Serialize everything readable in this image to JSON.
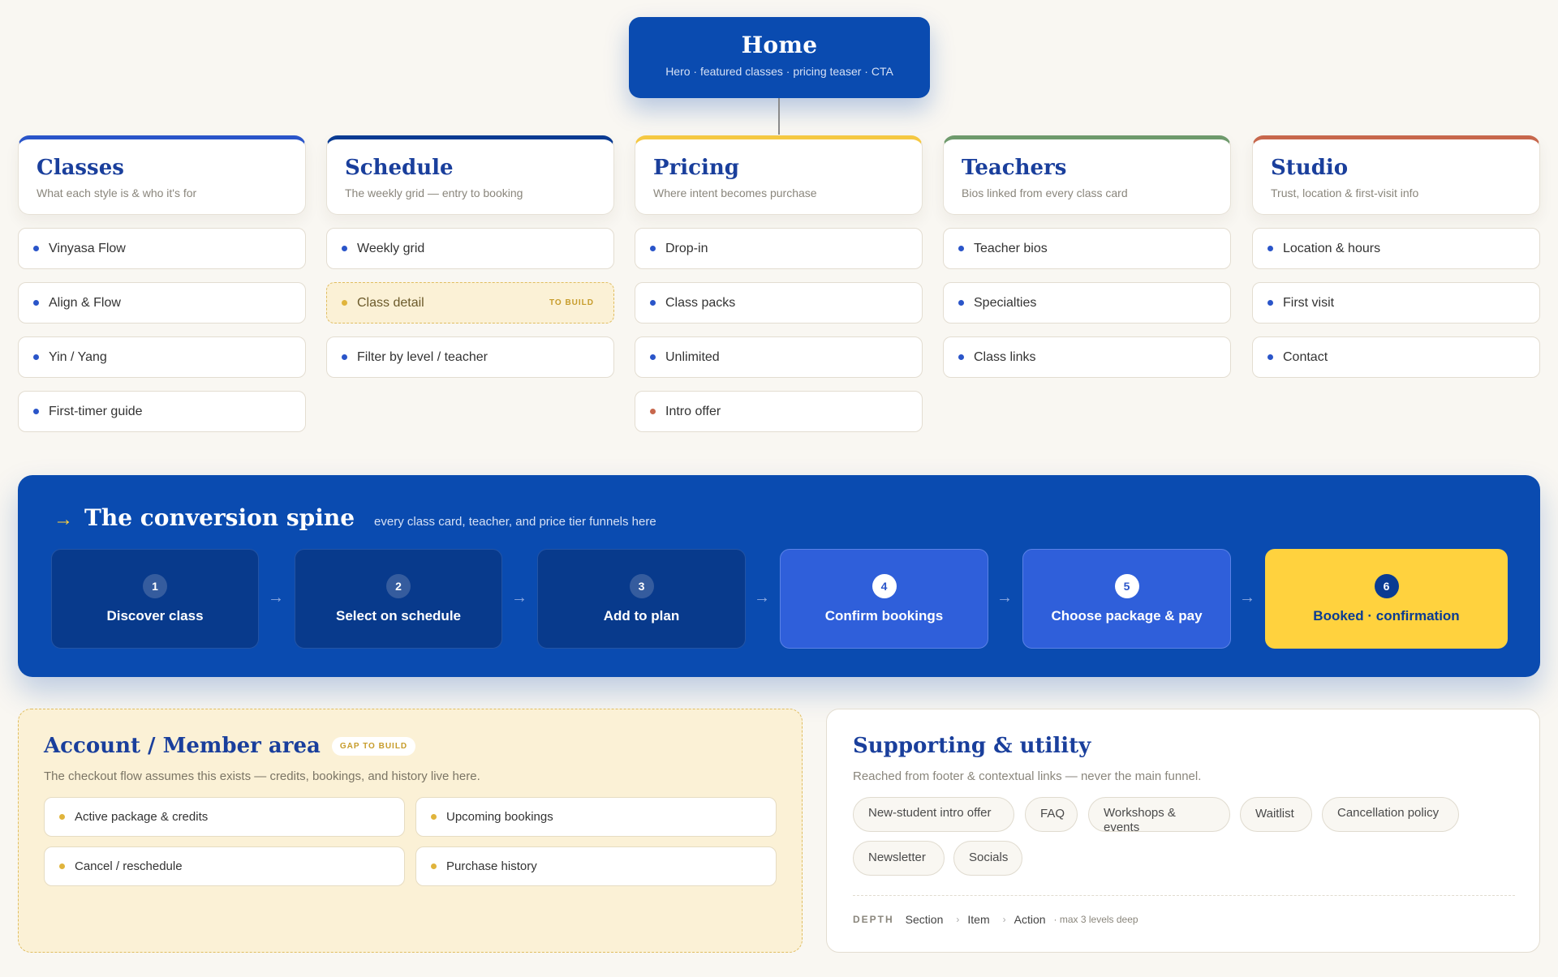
{
  "home": {
    "title": "Home",
    "subtitle": "Hero · featured classes · pricing teaser · CTA"
  },
  "colors": {
    "primary": "#0a4bb0",
    "classes": "#2a55c9",
    "schedule": "#0a3b92",
    "pricing": "#f5c842",
    "teachers": "#6e9a6c",
    "studio": "#c7674c",
    "gold": "#ffd23e",
    "gap_bg": "#fbf1d6"
  },
  "sections": [
    {
      "title": "Classes",
      "subtitle": "What each style is & who it's for",
      "items": [
        {
          "label": "Vinyasa Flow"
        },
        {
          "label": "Align & Flow"
        },
        {
          "label": "Yin / Yang"
        },
        {
          "label": "First-timer guide"
        }
      ]
    },
    {
      "title": "Schedule",
      "subtitle": "The weekly grid — entry to booking",
      "items": [
        {
          "label": "Weekly grid"
        },
        {
          "label": "Class detail",
          "tag": "TO BUILD"
        },
        {
          "label": "Filter by level / teacher"
        }
      ]
    },
    {
      "title": "Pricing",
      "subtitle": "Where intent becomes purchase",
      "items": [
        {
          "label": "Drop-in"
        },
        {
          "label": "Class packs"
        },
        {
          "label": "Unlimited"
        },
        {
          "label": "Intro offer"
        }
      ]
    },
    {
      "title": "Teachers",
      "subtitle": "Bios linked from every class card",
      "items": [
        {
          "label": "Teacher bios"
        },
        {
          "label": "Specialties"
        },
        {
          "label": "Class links"
        }
      ]
    },
    {
      "title": "Studio",
      "subtitle": "Trust, location & first-visit info",
      "items": [
        {
          "label": "Location & hours"
        },
        {
          "label": "First visit"
        },
        {
          "label": "Contact"
        }
      ]
    }
  ],
  "spine": {
    "arrow": "→",
    "title": "The conversion spine",
    "subtitle": "every class card, teacher, and price tier funnels here",
    "steps": [
      {
        "num": "1",
        "label": "Discover class"
      },
      {
        "num": "2",
        "label": "Select on schedule"
      },
      {
        "num": "3",
        "label": "Add to plan"
      },
      {
        "num": "4",
        "label": "Confirm bookings"
      },
      {
        "num": "5",
        "label": "Choose package & pay"
      },
      {
        "num": "6",
        "label": "Booked · confirmation"
      }
    ]
  },
  "account": {
    "title": "Account / Member area",
    "tag": "GAP TO BUILD",
    "subtitle": "The checkout flow assumes this exists — credits, bookings, and history live here.",
    "items": [
      {
        "label": "Active package & credits"
      },
      {
        "label": "Upcoming bookings"
      },
      {
        "label": "Cancel / reschedule"
      },
      {
        "label": "Purchase history"
      }
    ]
  },
  "support": {
    "title": "Supporting & utility",
    "subtitle": "Reached from footer & contextual links — never the main funnel.",
    "chips": [
      {
        "label": "New-student intro offer"
      },
      {
        "label": "FAQ"
      },
      {
        "label": "Workshops & events"
      },
      {
        "label": "Waitlist"
      },
      {
        "label": "Cancellation policy"
      },
      {
        "label": "Newsletter"
      },
      {
        "label": "Socials"
      }
    ],
    "depth": {
      "label": "DEPTH",
      "levels": [
        "Section",
        "Item",
        "Action"
      ],
      "separator": "›",
      "note": "· max 3 levels deep"
    }
  }
}
